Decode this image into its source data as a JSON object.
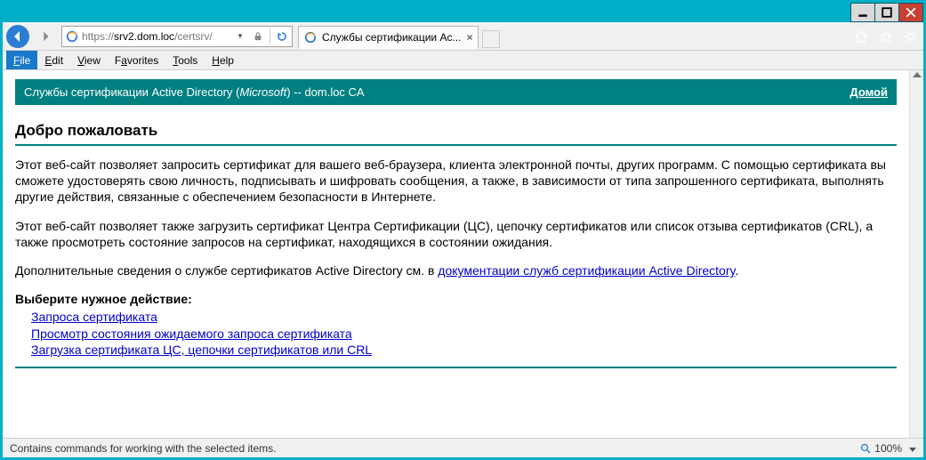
{
  "title_buttons": {
    "minimize": "minimize",
    "maximize": "maximize",
    "close": "close"
  },
  "address": {
    "scheme": "https://",
    "host": "srv2.dom.loc",
    "path": "/certsrv/",
    "full": "https://srv2.dom.loc/certsrv/"
  },
  "tab": {
    "title": "Службы сертификации Ac..."
  },
  "menu": {
    "file": "File",
    "edit": "Edit",
    "view": "View",
    "favorites": "Favorites",
    "tools": "Tools",
    "help": "Help"
  },
  "banner": {
    "prefix": "Службы сертификации Active Directory (",
    "brand": "Microsoft",
    "suffix": ")  --  dom.loc CA",
    "home": "Домой"
  },
  "page": {
    "welcome": "Добро пожаловать",
    "p1": "Этот веб-сайт позволяет запросить сертификат для вашего веб-браузера, клиента электронной почты, других программ. С помощью сертификата вы сможете удостоверять свою личность, подписывать и шифровать сообщения, а также, в зависимости от типа запрошенного сертификата, выполнять другие действия, связанные с обеспечением безопасности в Интернете.",
    "p2": "Этот веб-сайт позволяет также загрузить сертификат Центра Сертификации (ЦС), цепочку сертификатов или список отзыва сертификатов (CRL), а также просмотреть состояние запросов на сертификат, находящихся в состоянии ожидания.",
    "p3_prefix": "Дополнительные сведения о службе сертификатов Active Directory см. в ",
    "p3_link": "документации служб сертификации Active Directory",
    "p3_suffix": ".",
    "choose": "Выберите нужное действие:",
    "actions": [
      "Запроса сертификата",
      "Просмотр состояния ожидаемого запроса сертификата",
      "Загрузка сертификата ЦС, цепочки сертификатов или CRL"
    ]
  },
  "status": {
    "text": "Contains commands for working with the selected items.",
    "zoom": "100%"
  }
}
